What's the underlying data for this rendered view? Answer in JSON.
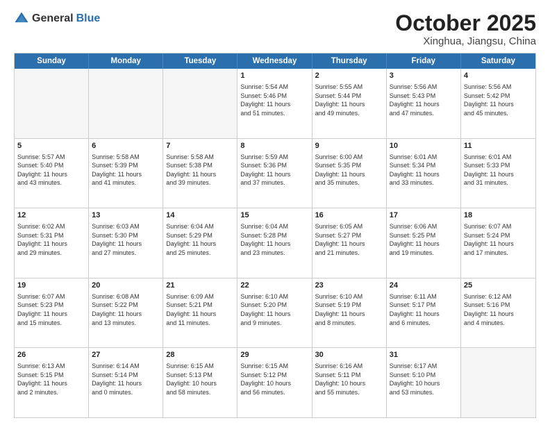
{
  "header": {
    "logo_general": "General",
    "logo_blue": "Blue",
    "title": "October 2025",
    "subtitle": "Xinghua, Jiangsu, China"
  },
  "weekdays": [
    "Sunday",
    "Monday",
    "Tuesday",
    "Wednesday",
    "Thursday",
    "Friday",
    "Saturday"
  ],
  "weeks": [
    [
      {
        "day": "",
        "info": "",
        "empty": true
      },
      {
        "day": "",
        "info": "",
        "empty": true
      },
      {
        "day": "",
        "info": "",
        "empty": true
      },
      {
        "day": "1",
        "info": "Sunrise: 5:54 AM\nSunset: 5:46 PM\nDaylight: 11 hours\nand 51 minutes."
      },
      {
        "day": "2",
        "info": "Sunrise: 5:55 AM\nSunset: 5:44 PM\nDaylight: 11 hours\nand 49 minutes."
      },
      {
        "day": "3",
        "info": "Sunrise: 5:56 AM\nSunset: 5:43 PM\nDaylight: 11 hours\nand 47 minutes."
      },
      {
        "day": "4",
        "info": "Sunrise: 5:56 AM\nSunset: 5:42 PM\nDaylight: 11 hours\nand 45 minutes."
      }
    ],
    [
      {
        "day": "5",
        "info": "Sunrise: 5:57 AM\nSunset: 5:40 PM\nDaylight: 11 hours\nand 43 minutes."
      },
      {
        "day": "6",
        "info": "Sunrise: 5:58 AM\nSunset: 5:39 PM\nDaylight: 11 hours\nand 41 minutes."
      },
      {
        "day": "7",
        "info": "Sunrise: 5:58 AM\nSunset: 5:38 PM\nDaylight: 11 hours\nand 39 minutes."
      },
      {
        "day": "8",
        "info": "Sunrise: 5:59 AM\nSunset: 5:36 PM\nDaylight: 11 hours\nand 37 minutes."
      },
      {
        "day": "9",
        "info": "Sunrise: 6:00 AM\nSunset: 5:35 PM\nDaylight: 11 hours\nand 35 minutes."
      },
      {
        "day": "10",
        "info": "Sunrise: 6:01 AM\nSunset: 5:34 PM\nDaylight: 11 hours\nand 33 minutes."
      },
      {
        "day": "11",
        "info": "Sunrise: 6:01 AM\nSunset: 5:33 PM\nDaylight: 11 hours\nand 31 minutes."
      }
    ],
    [
      {
        "day": "12",
        "info": "Sunrise: 6:02 AM\nSunset: 5:31 PM\nDaylight: 11 hours\nand 29 minutes."
      },
      {
        "day": "13",
        "info": "Sunrise: 6:03 AM\nSunset: 5:30 PM\nDaylight: 11 hours\nand 27 minutes."
      },
      {
        "day": "14",
        "info": "Sunrise: 6:04 AM\nSunset: 5:29 PM\nDaylight: 11 hours\nand 25 minutes."
      },
      {
        "day": "15",
        "info": "Sunrise: 6:04 AM\nSunset: 5:28 PM\nDaylight: 11 hours\nand 23 minutes."
      },
      {
        "day": "16",
        "info": "Sunrise: 6:05 AM\nSunset: 5:27 PM\nDaylight: 11 hours\nand 21 minutes."
      },
      {
        "day": "17",
        "info": "Sunrise: 6:06 AM\nSunset: 5:25 PM\nDaylight: 11 hours\nand 19 minutes."
      },
      {
        "day": "18",
        "info": "Sunrise: 6:07 AM\nSunset: 5:24 PM\nDaylight: 11 hours\nand 17 minutes."
      }
    ],
    [
      {
        "day": "19",
        "info": "Sunrise: 6:07 AM\nSunset: 5:23 PM\nDaylight: 11 hours\nand 15 minutes."
      },
      {
        "day": "20",
        "info": "Sunrise: 6:08 AM\nSunset: 5:22 PM\nDaylight: 11 hours\nand 13 minutes."
      },
      {
        "day": "21",
        "info": "Sunrise: 6:09 AM\nSunset: 5:21 PM\nDaylight: 11 hours\nand 11 minutes."
      },
      {
        "day": "22",
        "info": "Sunrise: 6:10 AM\nSunset: 5:20 PM\nDaylight: 11 hours\nand 9 minutes."
      },
      {
        "day": "23",
        "info": "Sunrise: 6:10 AM\nSunset: 5:19 PM\nDaylight: 11 hours\nand 8 minutes."
      },
      {
        "day": "24",
        "info": "Sunrise: 6:11 AM\nSunset: 5:17 PM\nDaylight: 11 hours\nand 6 minutes."
      },
      {
        "day": "25",
        "info": "Sunrise: 6:12 AM\nSunset: 5:16 PM\nDaylight: 11 hours\nand 4 minutes."
      }
    ],
    [
      {
        "day": "26",
        "info": "Sunrise: 6:13 AM\nSunset: 5:15 PM\nDaylight: 11 hours\nand 2 minutes."
      },
      {
        "day": "27",
        "info": "Sunrise: 6:14 AM\nSunset: 5:14 PM\nDaylight: 11 hours\nand 0 minutes."
      },
      {
        "day": "28",
        "info": "Sunrise: 6:15 AM\nSunset: 5:13 PM\nDaylight: 10 hours\nand 58 minutes."
      },
      {
        "day": "29",
        "info": "Sunrise: 6:15 AM\nSunset: 5:12 PM\nDaylight: 10 hours\nand 56 minutes."
      },
      {
        "day": "30",
        "info": "Sunrise: 6:16 AM\nSunset: 5:11 PM\nDaylight: 10 hours\nand 55 minutes."
      },
      {
        "day": "31",
        "info": "Sunrise: 6:17 AM\nSunset: 5:10 PM\nDaylight: 10 hours\nand 53 minutes."
      },
      {
        "day": "",
        "info": "",
        "empty": true
      }
    ]
  ]
}
